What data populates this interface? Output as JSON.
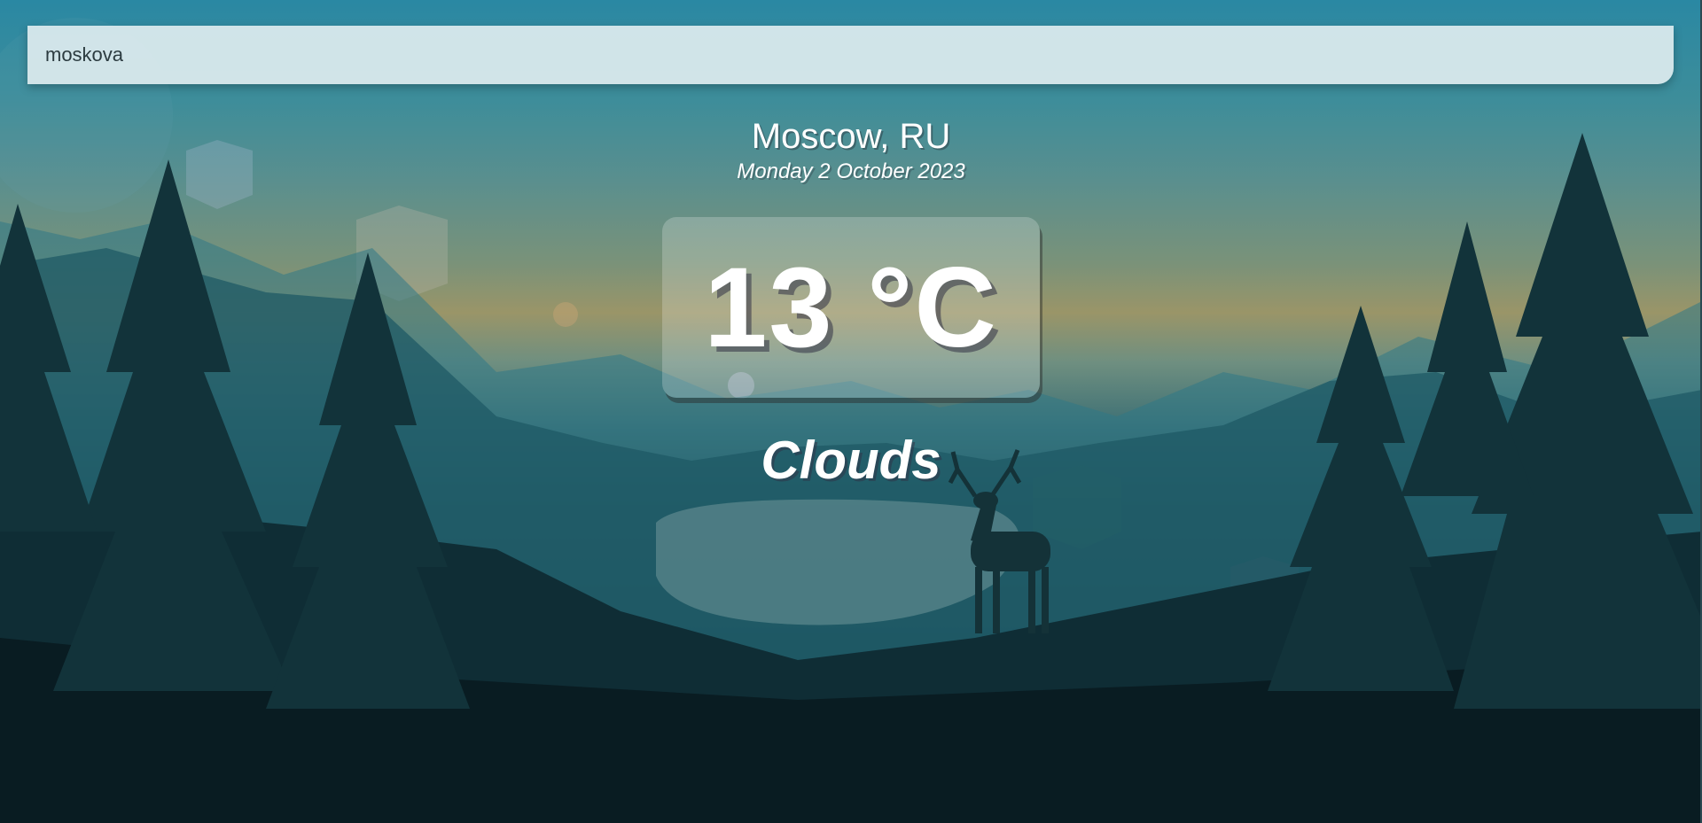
{
  "search": {
    "value": "moskova",
    "placeholder": ""
  },
  "location": {
    "city": "Moscow, RU",
    "date": "Monday 2 October 2023"
  },
  "weather": {
    "temperature": "13 °C",
    "condition": "Clouds"
  },
  "colors": {
    "sky_top": "#2a88a3",
    "horizon_glow": "#9a9568",
    "forest_dark": "#08191f",
    "text": "#ffffff"
  }
}
